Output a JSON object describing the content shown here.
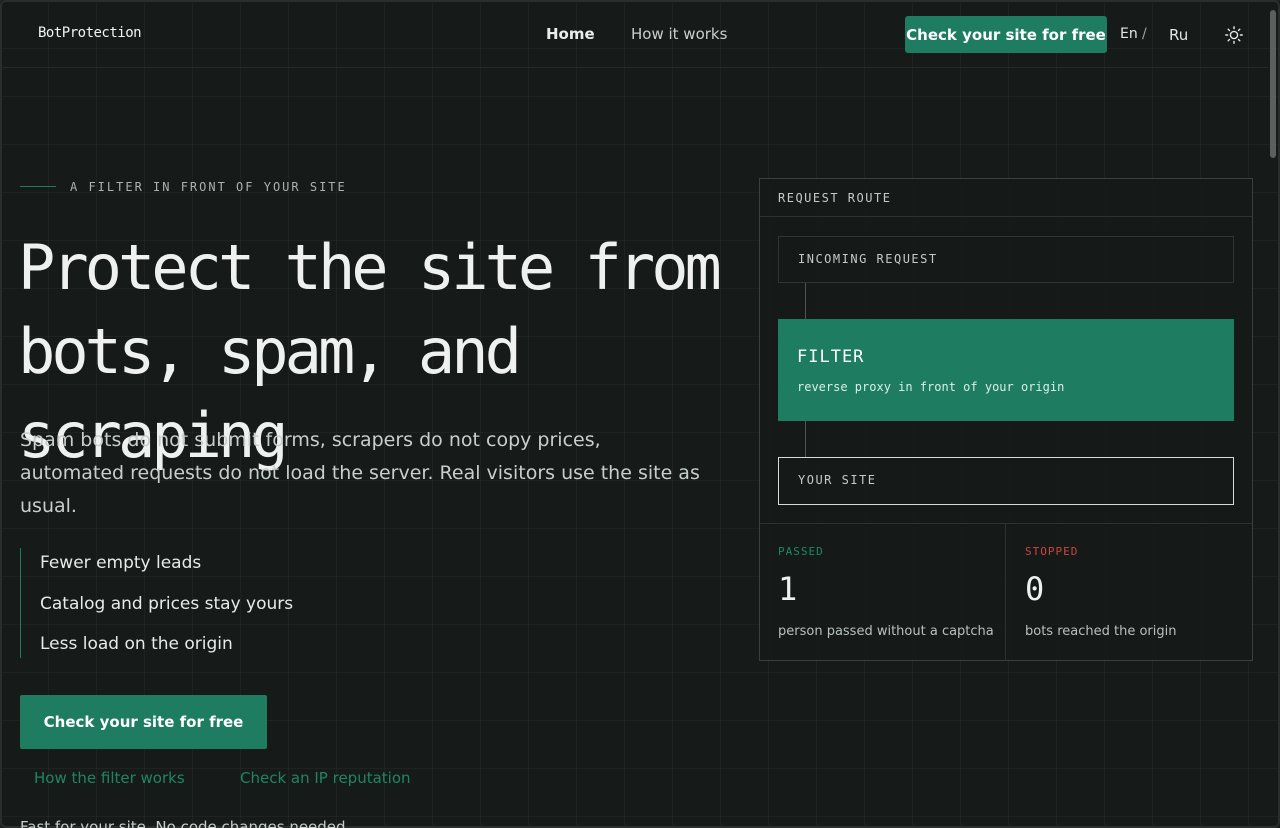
{
  "header": {
    "logo": "BotProtection",
    "nav": [
      {
        "label": "Home"
      },
      {
        "label": "How it works"
      }
    ],
    "cta_label": "Check your site for free",
    "lang_en": "En",
    "lang_sep": "/",
    "lang_ru": "Ru",
    "theme_icon": "sun-icon"
  },
  "hero": {
    "eyebrow": "A FILTER IN FRONT OF YOUR SITE",
    "title_line1": "Protect the site from",
    "title_line2": "bots, spam, and scraping",
    "lead": "Spam bots do not submit forms, scrapers do not copy prices, automated requests do not load the server. Real visitors use the site as usual.",
    "bullets": [
      "Fewer empty leads",
      "Catalog and prices stay yours",
      "Less load on the origin"
    ],
    "cta_label": "Check your site for free",
    "link_filter": "How the filter works",
    "link_ip": "Check an IP reputation",
    "cutoff": "Fast for your site. No code changes needed."
  },
  "route": {
    "title": "REQUEST ROUTE",
    "incoming": "INCOMING REQUEST",
    "filter_label": "FILTER",
    "filter_sub": "reverse proxy in front of your origin",
    "site": "YOUR SITE",
    "passed_label": "PASSED",
    "passed_value": "1",
    "passed_desc": "person passed without a captcha",
    "stopped_label": "STOPPED",
    "stopped_value": "0",
    "stopped_desc": "bots reached the origin"
  },
  "colors": {
    "accent": "#1e7c60",
    "passed": "#1f8665",
    "stopped": "#c9463d",
    "background": "#161a19"
  }
}
